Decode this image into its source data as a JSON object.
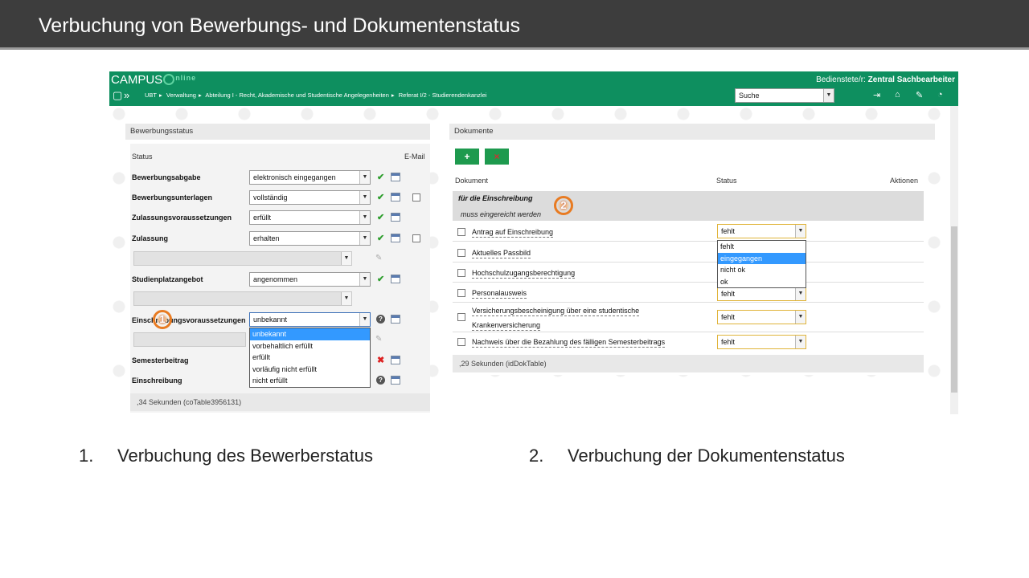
{
  "slide": {
    "title": "Verbuchung von Bewerbungs- und Dokumentenstatus"
  },
  "app": {
    "logo": {
      "part1": "CAMPUS",
      "part2": "nline"
    },
    "user_prefix": "Bedienstete/r:",
    "user_name": "Zentral Sachbearbeiter",
    "breadcrumb": [
      "UBT",
      "Verwaltung",
      "Abteilung I - Recht, Akademische und Studentische Angelegenheiten",
      "Referat I/2 - Studierendenkanzlei"
    ],
    "search": {
      "value": "Suche"
    }
  },
  "bewerbung": {
    "panel_title": "Bewerbungsstatus",
    "col_status": "Status",
    "col_email": "E-Mail",
    "rows": [
      {
        "label": "Bewerbungsabgabe",
        "value": "elektronisch eingegangen"
      },
      {
        "label": "Bewerbungsunterlagen",
        "value": "vollständig"
      },
      {
        "label": "Zulassungsvoraussetzungen",
        "value": "erfüllt"
      },
      {
        "label": "Zulassung",
        "value": "erhalten"
      },
      {
        "label": "Studienplatzangebot",
        "value": "angenommen"
      },
      {
        "label": "Einschreibungsvoraussetzungen",
        "value": "unbekannt"
      },
      {
        "label": "Semesterbeitrag",
        "value": ""
      },
      {
        "label": "Einschreibung",
        "value": ""
      }
    ],
    "dropdown_options": [
      "unbekannt",
      "vorbehaltlich erfüllt",
      "erfüllt",
      "vorläufig nicht erfüllt",
      "nicht erfüllt"
    ],
    "footer": ",34 Sekunden (coTable3956131)"
  },
  "dokumente": {
    "panel_title": "Dokumente",
    "btn_add": "+",
    "btn_remove": "×",
    "col_dokument": "Dokument",
    "col_status": "Status",
    "col_aktionen": "Aktionen",
    "group_title": "für die Einschreibung",
    "group_sub": "muss eingereicht werden",
    "docs": [
      {
        "name": "Antrag auf Einschreibung",
        "status": "fehlt"
      },
      {
        "name": "Aktuelles Passbild",
        "status": ""
      },
      {
        "name": "Hochschulzugangsberechtigung",
        "status": ""
      },
      {
        "name": "Personalausweis",
        "status": "fehlt"
      },
      {
        "name_line1": "Versicherungsbescheinigung über eine studentische",
        "name_line2": "Krankenversicherung",
        "status": "fehlt"
      },
      {
        "name": "Nachweis über die Bezahlung des fälligen Semesterbeitrags",
        "status": "fehlt"
      }
    ],
    "dropdown_options": [
      "fehlt",
      "eingegangen",
      "nicht ok",
      "ok"
    ],
    "footer": ",29 Sekunden (idDokTable)"
  },
  "markers": {
    "m1": "1",
    "m2": "2"
  },
  "captions": [
    {
      "num": "1.",
      "text": "Verbuchung des Bewerberstatus"
    },
    {
      "num": "2.",
      "text": "Verbuchung der Dokumentenstatus"
    }
  ],
  "colors": {
    "topbar": "#0e8f5f",
    "header": "#3d3d3d",
    "accent_add": "#1e9a4e",
    "highlight": "#3399ff",
    "marker": "#e87b22"
  }
}
